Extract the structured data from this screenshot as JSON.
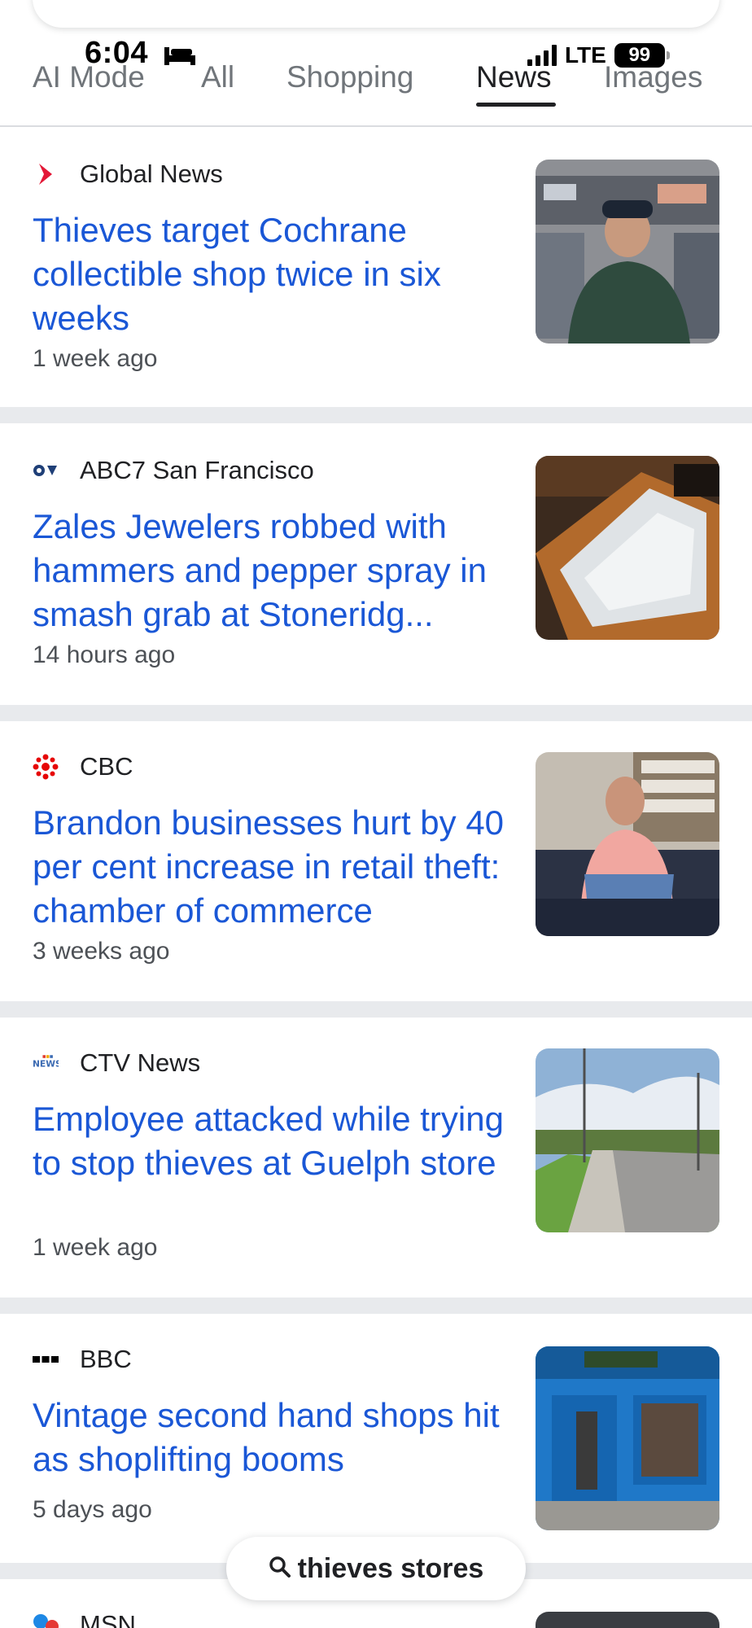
{
  "status_bar": {
    "time": "6:04",
    "network": "LTE",
    "battery": "99"
  },
  "tabs": [
    {
      "label": "AI Mode"
    },
    {
      "label": "All"
    },
    {
      "label": "Shopping"
    },
    {
      "label": "News",
      "selected": true
    },
    {
      "label": "Images"
    }
  ],
  "articles": [
    {
      "source": "Global News",
      "headline": "Thieves target Cochrane collectible shop twice in six weeks",
      "age": "1 week ago"
    },
    {
      "source": "ABC7 San Francisco",
      "headline": "Zales Jewelers robbed with hammers and pepper spray in smash grab at Stoneridg...",
      "age": "14 hours ago"
    },
    {
      "source": "CBC",
      "headline": "Brandon businesses hurt by 40 per cent increase in retail theft: chamber of commerce",
      "age": "3 weeks ago"
    },
    {
      "source": "CTV News",
      "headline": "Employee attacked while trying to stop thieves at Guelph store",
      "age": "1 week ago"
    },
    {
      "source": "BBC",
      "headline": "Vintage second hand shops hit as shoplifting booms",
      "age": "5 days ago"
    },
    {
      "source": "MSN"
    }
  ],
  "search_pill": {
    "query": "thieves stores"
  },
  "colors": {
    "link": "#1a57d6",
    "separator": "#e8eaed",
    "global_news": "#e31837",
    "cbc": "#e60505"
  }
}
